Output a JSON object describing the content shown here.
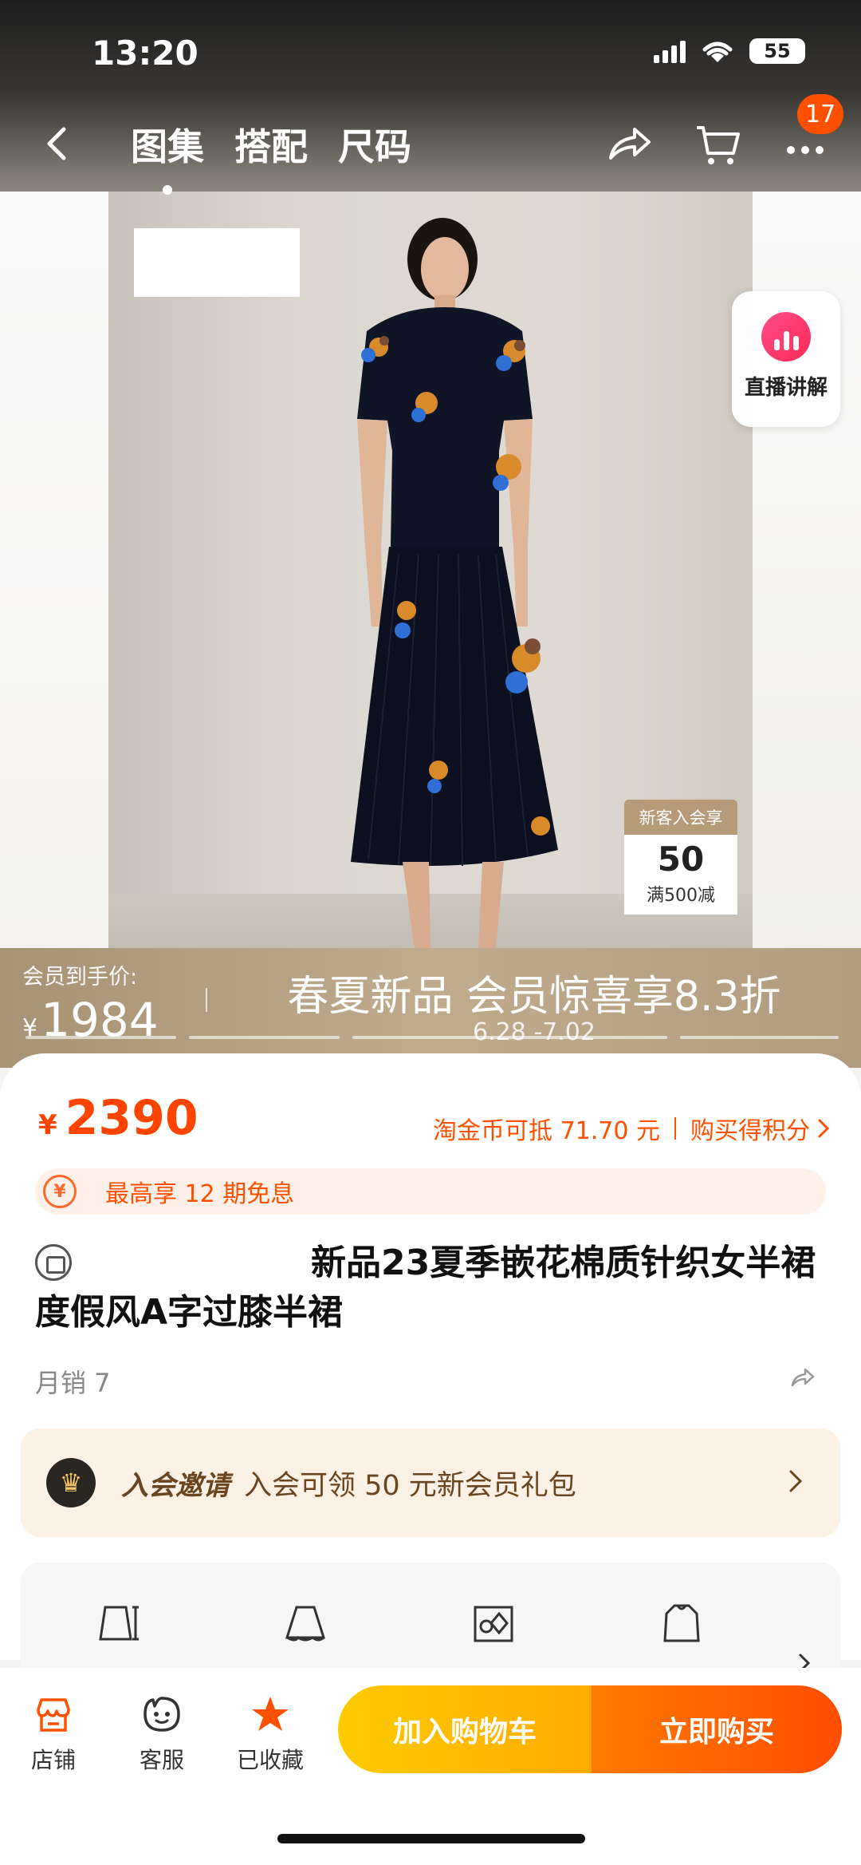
{
  "status_bar": {
    "time": "13:20",
    "battery": "55"
  },
  "nav": {
    "tabs": [
      {
        "label": "图集",
        "active": true
      },
      {
        "label": "搭配",
        "active": false
      },
      {
        "label": "尺码",
        "active": false
      }
    ],
    "badge_count": "17"
  },
  "live": {
    "label": "直播讲解"
  },
  "coupon_tag": {
    "head": "新客入会享",
    "amount": "50",
    "condition": "满500减"
  },
  "promo": {
    "member_price_label": "会员到手价:",
    "currency": "¥",
    "member_price": "1984",
    "headline": "春夏新品 会员惊喜享8.3折",
    "dates": "6.28 -7.02"
  },
  "product": {
    "currency": "¥",
    "price": "2390",
    "coin_text": "淘金币可抵 71.70 元",
    "points_text": "购买得积分",
    "installment_icon": "¥",
    "installment_text": "最高享 12 期免息",
    "title": "新品23夏季嵌花棉质针织女半裙度假风A字过膝半裙",
    "sales": "月销 7"
  },
  "member": {
    "title": "入会邀请",
    "text": "入会可领 50 元新会员礼包"
  },
  "bottom_bar": {
    "shop": "店铺",
    "service": "客服",
    "favorite": "已收藏",
    "add_to_cart": "加入购物车",
    "buy_now": "立即购买"
  },
  "colors": {
    "accent": "#ff5000",
    "cart_button": "#ffb800",
    "buy_button": "#ff5500",
    "member_text": "#6b4520"
  }
}
